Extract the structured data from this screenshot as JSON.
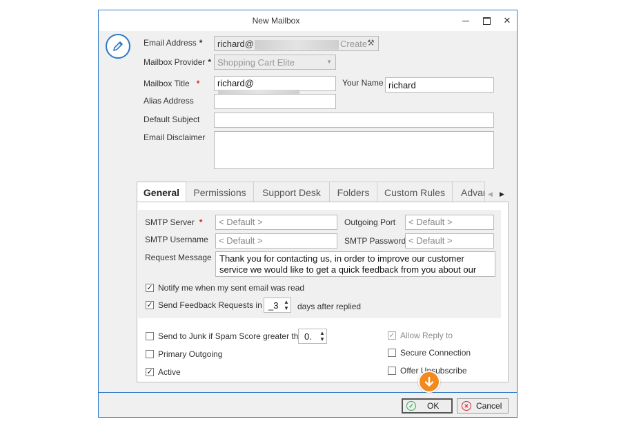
{
  "window": {
    "title": "New Mailbox"
  },
  "form": {
    "email_label": "Email Address",
    "email_value": "richard@",
    "create_label": "Create",
    "provider_label": "Mailbox Provider",
    "provider_value": "Shopping Cart Elite",
    "title_label": "Mailbox Title",
    "title_value": "richard@",
    "yourname_label": "Your Name",
    "yourname_value": "richard",
    "alias_label": "Alias Address",
    "alias_value": "",
    "subject_label": "Default Subject",
    "subject_value": "",
    "disclaimer_label": "Email Disclaimer",
    "disclaimer_value": "",
    "required_mark": "*"
  },
  "tabs": [
    {
      "label": "General"
    },
    {
      "label": "Permissions"
    },
    {
      "label": "Support Desk"
    },
    {
      "label": "Folders"
    },
    {
      "label": "Custom Rules"
    },
    {
      "label": "Advar"
    }
  ],
  "general": {
    "smtp_server_label": "SMTP Server",
    "smtp_server_value": "< Default >",
    "port_label": "Outgoing Port",
    "port_value": "< Default >",
    "smtp_user_label": "SMTP Username",
    "smtp_user_value": "< Default >",
    "smtp_pass_label": "SMTP Password",
    "smtp_pass_value": "< Default >",
    "request_label": "Request Message",
    "request_line1": "Thank you for contacting us, in order to improve our customer",
    "request_line2": "service we would like to get a quick feedback from you about our",
    "notify_label": "Notify me when my sent email was read",
    "feedback_label": "Send Feedback Requests in",
    "feedback_days": "_3",
    "feedback_suffix": "days after replied",
    "junk_label": "Send to Junk if Spam Score greater than",
    "junk_value": "0.",
    "primary_label": "Primary Outgoing",
    "active_label": "Active",
    "allow_reply_label": "Allow Reply to",
    "secure_label": "Secure Connection",
    "unsub_label": "Offer Unsubscribe",
    "check_mark": "✓"
  },
  "footer": {
    "ok_label": "OK",
    "cancel_label": "Cancel"
  },
  "colors": {
    "accent": "#2b78c5",
    "orange": "#f28a1e",
    "ok_green": "#3aa757",
    "cancel_red": "#d7262b"
  }
}
